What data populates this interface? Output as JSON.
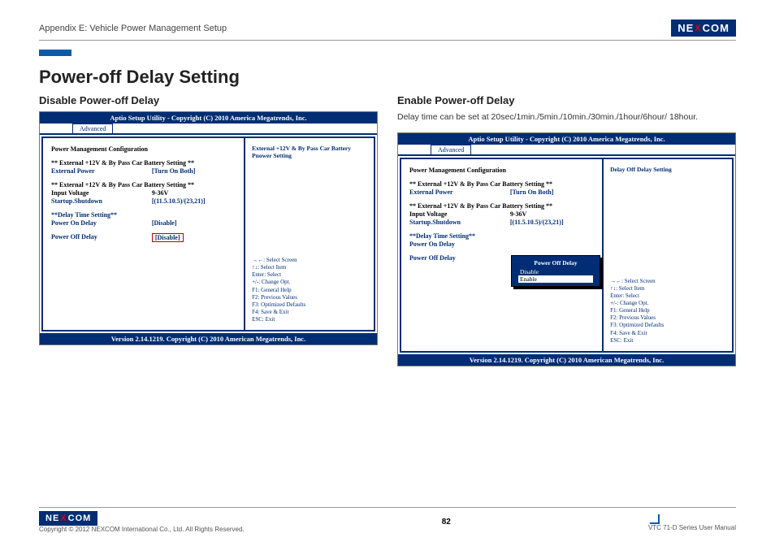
{
  "header": {
    "appendix": "Appendix E: Vehicle Power Management Setup",
    "brand_left": "NE",
    "brand_x": "X",
    "brand_right": "COM"
  },
  "title": "Power-off Delay Setting",
  "left": {
    "heading": "Disable Power-off Delay",
    "bios": {
      "topbar": "Aptio Setup Utility - Copyright (C) 2010 America Megatrends, Inc.",
      "tab": "Advanced",
      "section1": "Power Management Configuration",
      "s2": "** External +12V & By Pass Car Battery Setting **",
      "ext_pwr_k": "External Power",
      "ext_pwr_v": "[Turn On Both]",
      "s3": "** External +12V & By Pass Car Battery Setting **",
      "iv_k": "Input Voltage",
      "iv_v": "9-36V",
      "ss_k": "Startup.Shutdown",
      "ss_v": "[(11.5.10.5)/(23,21)]",
      "s4": "**Delay Time Setting**",
      "pon_k": "Power On Delay",
      "pon_v": "[Disable]",
      "poff_k": "Power Off Delay",
      "poff_v": "[Disable]",
      "right_title": "External +12V & By Pass Car Battery Pnower Setting",
      "hints": [
        "→←: Select Screen",
        "↑↓: Select Item",
        "Enter: Select",
        "+/-: Change Opt.",
        "F1: General Help",
        "F2: Previous Values",
        "F3: Optimized Defaults",
        "F4: Save & Exit",
        "ESC: Exit"
      ],
      "bottom": "Version 2.14.1219. Copyright (C) 2010 American Megatrends, Inc."
    }
  },
  "right": {
    "heading": "Enable Power-off Delay",
    "desc": "Delay time can be set at 20sec/1min./5min./10min./30min./1hour/6hour/ 18hour.",
    "bios": {
      "topbar": "Aptio Setup Utility - Copyright (C) 2010 America Megatrends, Inc.",
      "tab": "Advanced",
      "section1": "Power Management Configuration",
      "s2": "** External +12V & By Pass Car Battery Setting **",
      "ext_pwr_k": "External Power",
      "ext_pwr_v": "[Turn On Both]",
      "s3": "** External +12V & By Pass Car Battery Setting **",
      "iv_k": "Input Voltage",
      "iv_v": "9-36V",
      "ss_k": "Startup.Shutdown",
      "ss_v": "[(11.5.10.5)/(23,21)]",
      "s4": "**Delay Time Setting**",
      "pon_k": "Power On Delay",
      "poff_k": "Power Off Delay",
      "right_title": "Delay Off Delay Setting",
      "popup_title": "Power Off Delay",
      "popup_opts": [
        "Disable",
        "Enable"
      ],
      "hints": [
        "→←: Select Screen",
        "↑↓: Select Item",
        "Enter: Select",
        "+/-: Change Opt.",
        "F1: General Help",
        "F2: Previous Values",
        "F3: Optimized Defaults",
        "F4: Save & Exit",
        "ESC: Exit"
      ],
      "bottom": "Version 2.14.1219. Copyright (C) 2010 American Megatrends, Inc."
    }
  },
  "footer": {
    "copy": "Copyright © 2012 NEXCOM International Co., Ltd. All Rights Reserved.",
    "page": "82",
    "manual": "VTC 71-D Series User Manual"
  }
}
